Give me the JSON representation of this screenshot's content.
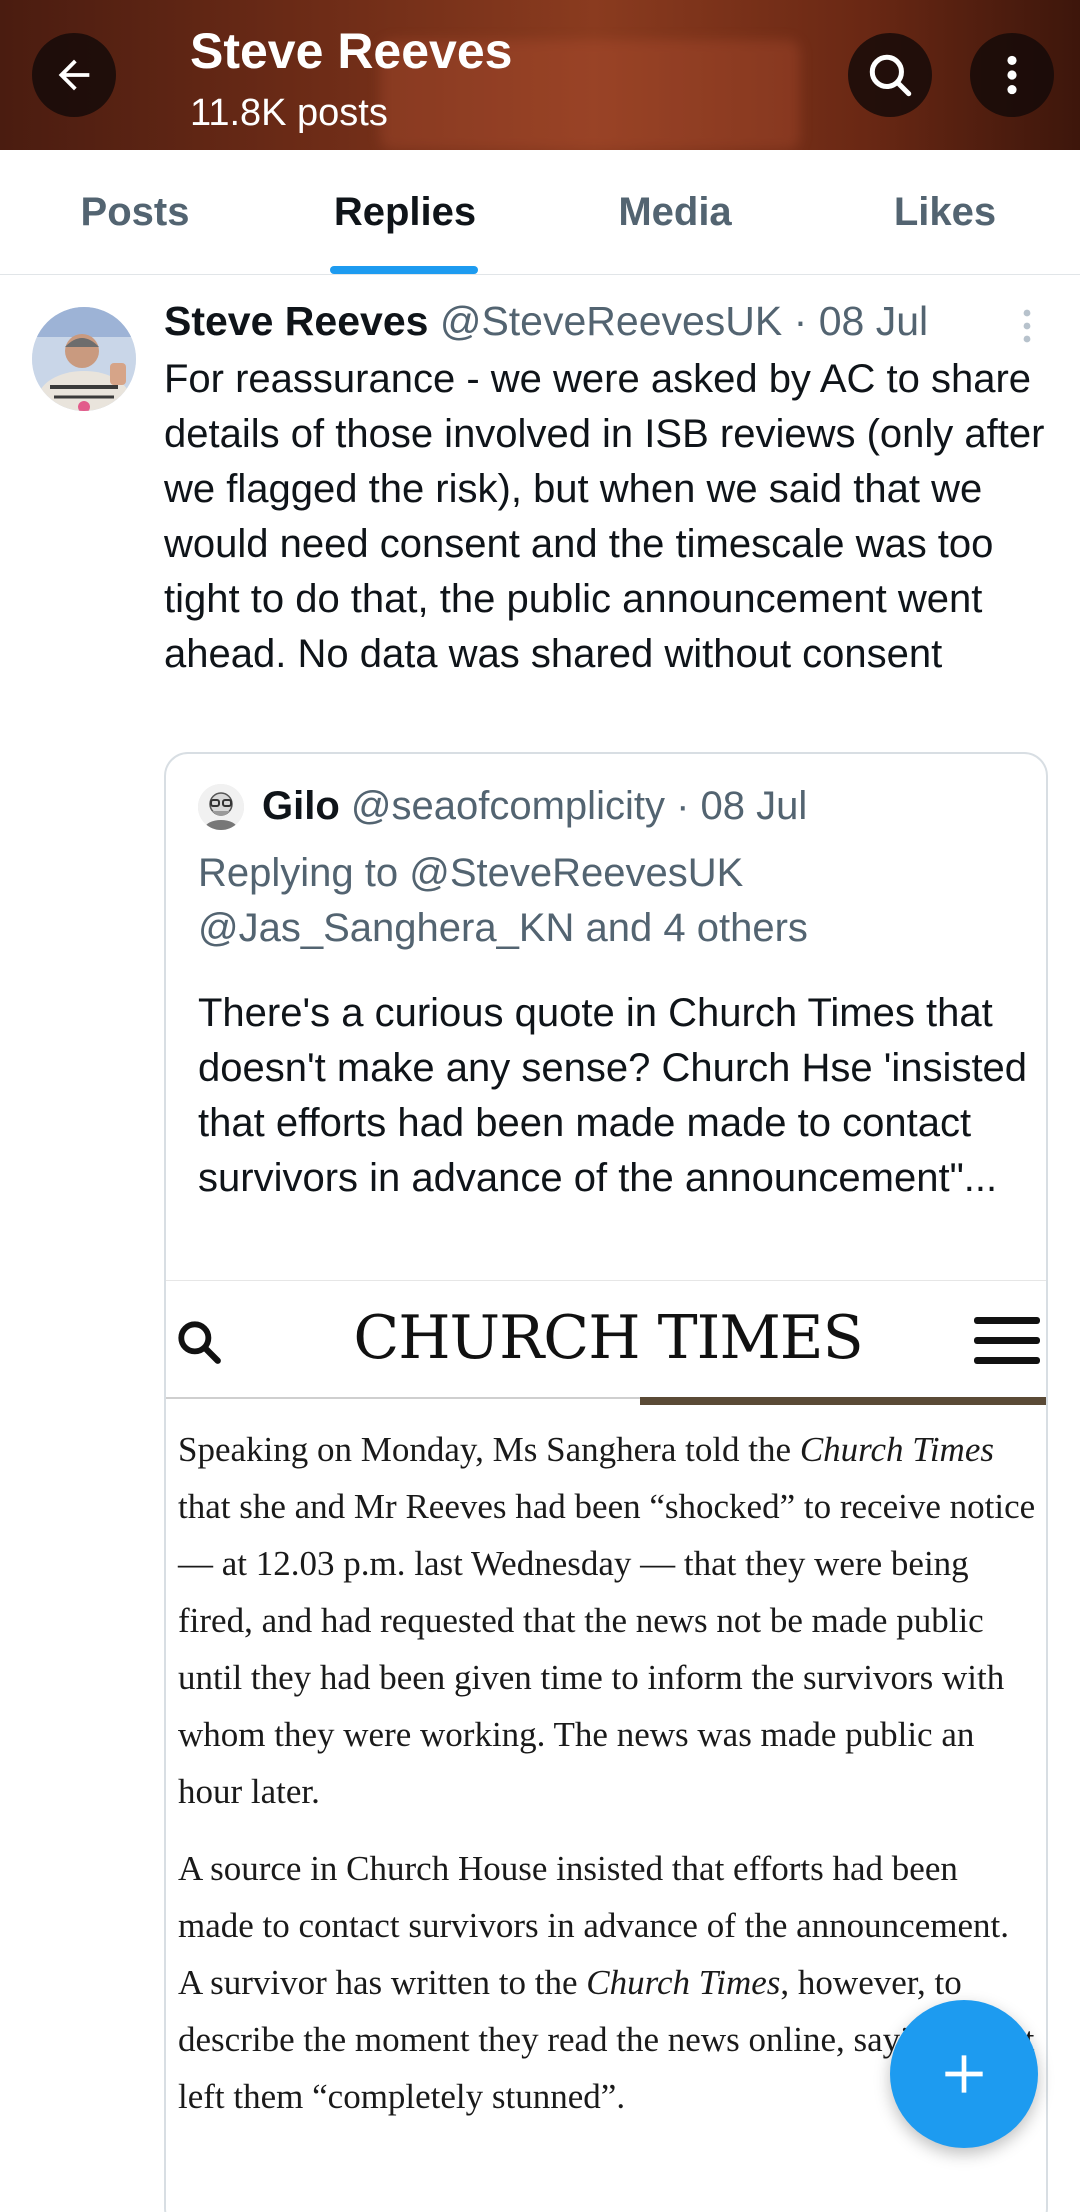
{
  "header": {
    "title": "Steve Reeves",
    "subtitle": "11.8K posts",
    "back_icon": "back-arrow-icon",
    "search_icon": "search-icon",
    "more_icon": "more-vertical-icon"
  },
  "tabs": [
    {
      "label": "Posts"
    },
    {
      "label": "Replies",
      "active": true
    },
    {
      "label": "Media"
    },
    {
      "label": "Likes"
    }
  ],
  "tweet": {
    "name": "Steve Reeves",
    "handle": "@SteveReevesUK",
    "separator": " · ",
    "date": "08 Jul",
    "text": "For reassurance - we were asked by AC to share details of those involved in ISB reviews (only after we flagged the risk), but when we said that we would need consent and the timescale was too tight to do that, the public announcement went ahead. No data was shared without consent"
  },
  "quote": {
    "name": "Gilo",
    "handle": "@seaofcomplicity",
    "separator": " · ",
    "date": "08 Jul",
    "replying_line1": "Replying to @SteveReevesUK",
    "replying_line2": "@Jas_Sanghera_KN and 4 others",
    "text": "There's a curious quote in Church Times that doesn't make any sense? Church Hse 'insisted that efforts had been made made to contact survivors in advance of the announcement\"..."
  },
  "church_times": {
    "logo": "CHURCH TIMES",
    "p1_a": "Speaking on Monday, Ms Sanghera told the ",
    "p1_em": "Church Times",
    "p1_b": " that she and Mr Reeves had been “shocked” to receive notice — at 12.03 p.m. last Wednesday — that they were being fired, and had requested that the news not be made public until they had been given time to inform the survivors with whom they were working. The news was made public an hour later.",
    "p2_a": "A source in Church House insisted that efforts had been made to contact survivors in advance of the announcement. A survivor has written to the ",
    "p2_em": "Church Times",
    "p2_b": ", however, to describe the moment they read the news online, saying that it left them “completely stunned”."
  },
  "fab": {
    "icon": "plus-icon",
    "accent": "#1d9bf0"
  }
}
